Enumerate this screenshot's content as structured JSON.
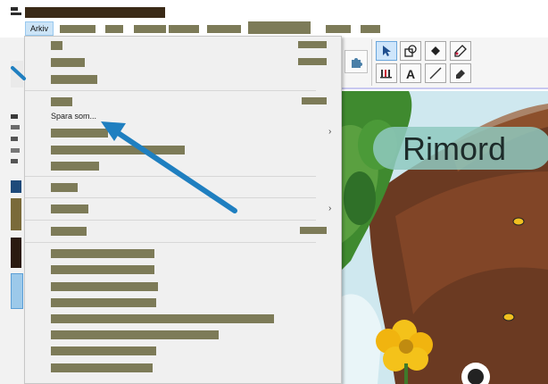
{
  "menubar": {
    "arkiv_label": "Arkiv"
  },
  "dropdown": {
    "spara_som_label": "Spara som...",
    "submenu_chevron": "›"
  },
  "canvas": {
    "rimord_label": "Rimord"
  },
  "toolbar": {
    "tools": [
      "pointer-icon",
      "shape-icon",
      "fill-icon",
      "eraser-dropper-icon",
      "people-icon",
      "text-icon",
      "line-icon",
      "eraser-icon",
      "puzzle-icon"
    ]
  },
  "colors": {
    "accent": "#1f7fc0",
    "redaction": "#7d7b58"
  }
}
